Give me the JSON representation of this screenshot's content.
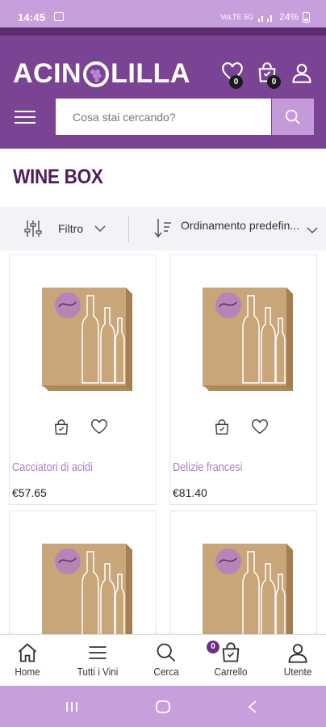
{
  "status_bar": {
    "time": "14:45",
    "network": "VoLTE 5G",
    "battery": "24%"
  },
  "header": {
    "logo_text_left": "ACIN",
    "logo_text_right": "LILLA",
    "wishlist_count": "0",
    "cart_count": "0",
    "search_placeholder": "Cosa stai cercando?"
  },
  "page": {
    "title": "WINE BOX"
  },
  "filter_bar": {
    "filter_label": "Filtro",
    "sort_label": "Ordinamento predefin..."
  },
  "products": [
    {
      "name": "Cacciatori di acidi",
      "price": "€57.65"
    },
    {
      "name": "Delizie francesi",
      "price": "€81.40"
    },
    {
      "name": "",
      "price": ""
    },
    {
      "name": "",
      "price": ""
    }
  ],
  "bottom_nav": {
    "items": [
      {
        "label": "Home",
        "icon": "home-icon"
      },
      {
        "label": "Tutti i Vini",
        "icon": "list-icon"
      },
      {
        "label": "Cerca",
        "icon": "search-icon"
      },
      {
        "label": "Carrello",
        "icon": "cart-icon",
        "badge": "0"
      },
      {
        "label": "Utente",
        "icon": "user-icon"
      }
    ]
  },
  "colors": {
    "brand_purple": "#7b4393",
    "light_purple": "#c49adb",
    "title_purple": "#4a1f5c",
    "product_name": "#b07ad0"
  }
}
